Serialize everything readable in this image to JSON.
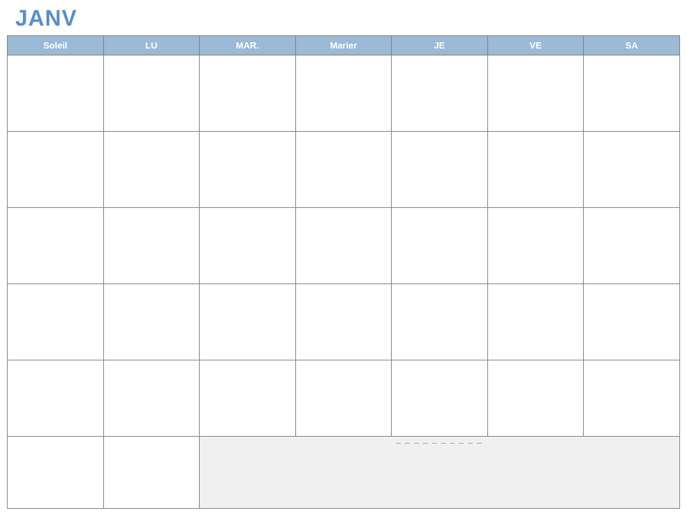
{
  "month_title": "JANV",
  "weekdays": [
    "Soleil",
    "LU",
    "MAR.",
    "Marier",
    "JE",
    "VE",
    "SA"
  ],
  "notes_placeholder": "— — — — — — — — — —",
  "colors": {
    "title": "#5a8fc2",
    "header_bg": "#9cb9d6",
    "header_text": "#ffffff",
    "grid_border": "#808080",
    "notes_bg": "#f0f0f0"
  }
}
